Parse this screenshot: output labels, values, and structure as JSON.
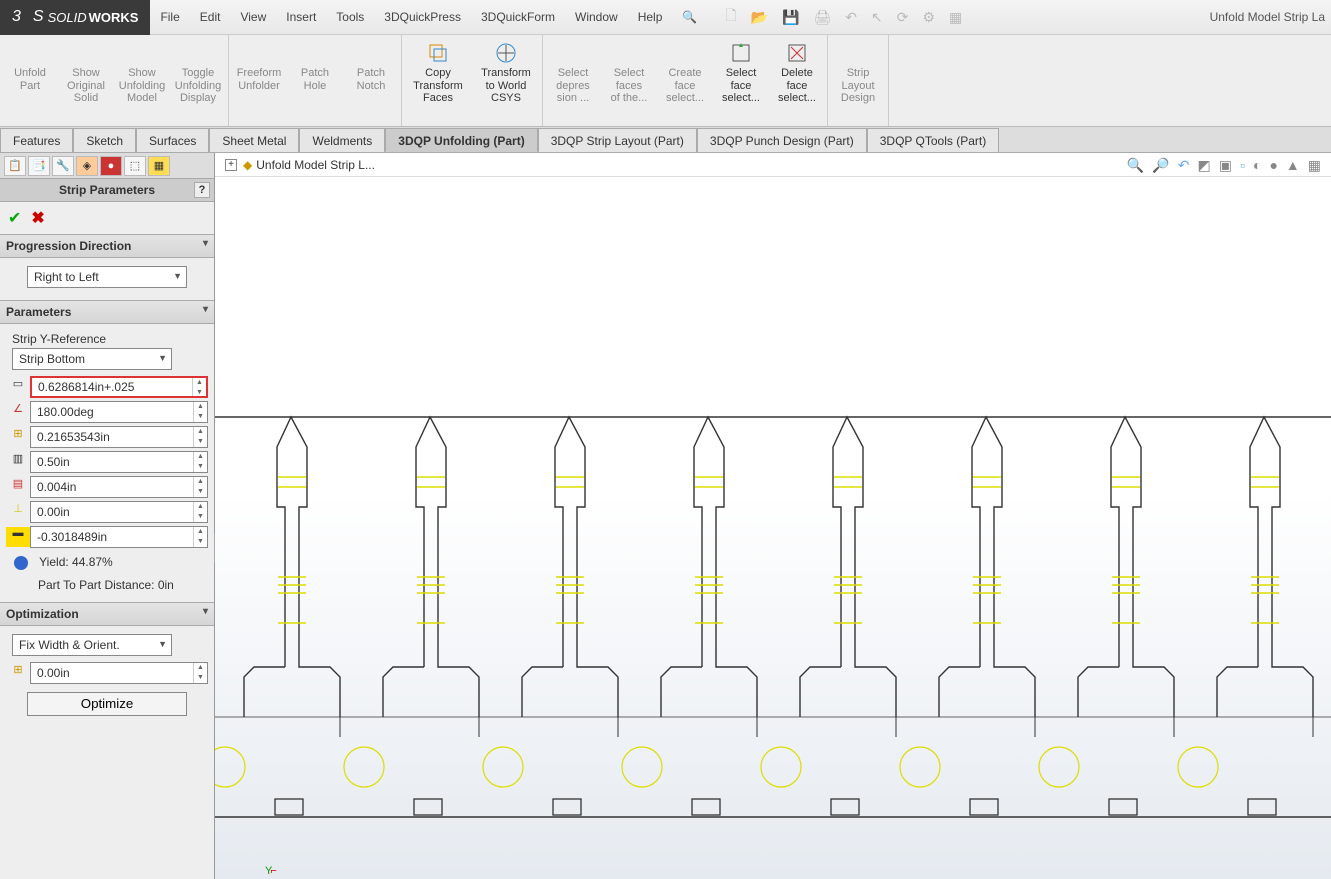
{
  "app": {
    "brand_prefix": "SOLID",
    "brand_suffix": "WORKS",
    "title": "Unfold Model Strip La"
  },
  "menu": [
    "File",
    "Edit",
    "View",
    "Insert",
    "Tools",
    "3DQuickPress",
    "3DQuickForm",
    "Window",
    "Help"
  ],
  "ribbon": [
    {
      "label": "Unfold\nPart",
      "en": false
    },
    {
      "label": "Show\nOriginal\nSolid",
      "en": false
    },
    {
      "label": "Show\nUnfolding\nModel",
      "en": false
    },
    {
      "label": "Toggle\nUnfolding\nDisplay",
      "en": false
    },
    {
      "label": "Freeform\nUnfolder",
      "en": false
    },
    {
      "label": "Patch\nHole",
      "en": false
    },
    {
      "label": "Patch\nNotch",
      "en": false
    },
    {
      "label": "Copy\nTransform\nFaces",
      "en": true
    },
    {
      "label": "Transform\nto World\nCSYS",
      "en": true
    },
    {
      "label": "Select\ndepres\nsion ...",
      "en": false
    },
    {
      "label": "Select\nfaces\nof the...",
      "en": false
    },
    {
      "label": "Create\nface\nselect...",
      "en": false
    },
    {
      "label": "Select\nface\nselect...",
      "en": true
    },
    {
      "label": "Delete\nface\nselect...",
      "en": true
    },
    {
      "label": "Strip\nLayout\nDesign",
      "en": false
    }
  ],
  "tabs": [
    "Features",
    "Sketch",
    "Surfaces",
    "Sheet Metal",
    "Weldments",
    "3DQP Unfolding (Part)",
    "3DQP Strip Layout (Part)",
    "3DQP Punch Design (Part)",
    "3DQP QTools (Part)"
  ],
  "active_tab": 5,
  "panel": {
    "title": "Strip Parameters",
    "sections": {
      "prog": {
        "header": "Progression Direction",
        "value": "Right to Left"
      },
      "params": {
        "header": "Parameters",
        "yref_label": "Strip Y-Reference",
        "yref_value": "Strip Bottom",
        "values": [
          "0.6286814in+.025",
          "180.00deg",
          "0.21653543in",
          "0.50in",
          "0.004in",
          "0.00in",
          "-0.3018489in"
        ],
        "yield": "Yield: 44.87%",
        "ptp": "Part To Part Distance: 0in"
      },
      "opt": {
        "header": "Optimization",
        "mode": "Fix Width & Orient.",
        "val": "0.00in",
        "btn": "Optimize"
      }
    }
  },
  "breadcrumb": "Unfold Model Strip L..."
}
